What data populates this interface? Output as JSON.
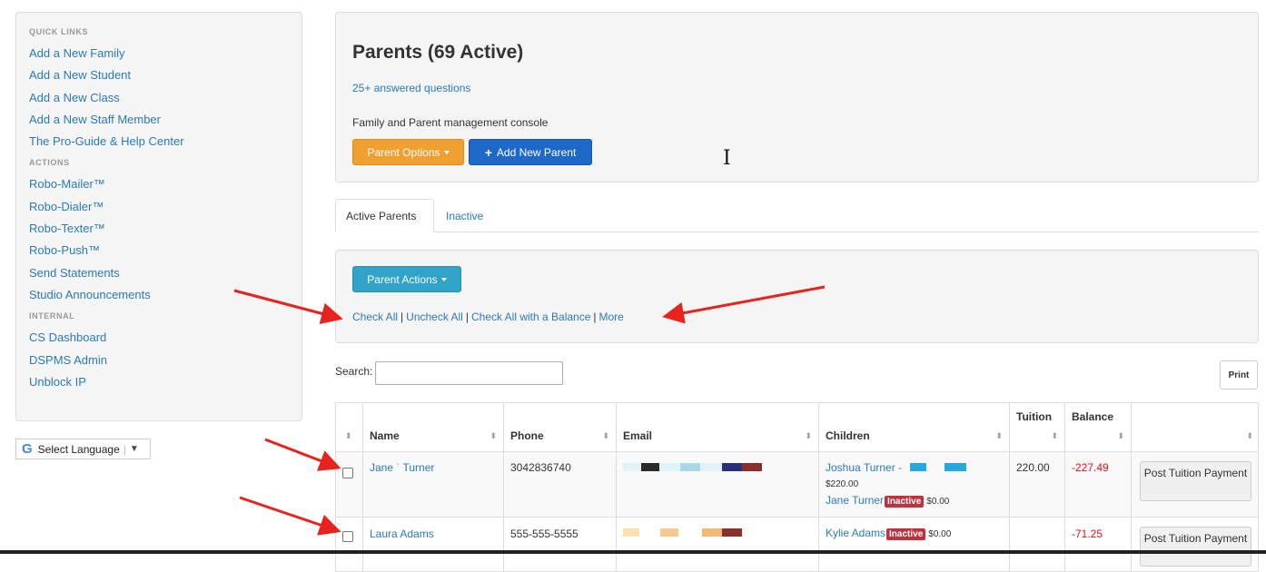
{
  "sidebar": {
    "sections": [
      {
        "heading": "QUICK LINKS",
        "links": [
          "Add a New Family",
          "Add a New Student",
          "Add a New Class",
          "Add a New Staff Member",
          "The Pro-Guide & Help Center"
        ]
      },
      {
        "heading": "ACTIONS",
        "links": [
          "Robo-Mailer™",
          "Robo-Dialer™",
          "Robo-Texter™",
          "Robo-Push™",
          "Send Statements",
          "Studio Announcements"
        ]
      },
      {
        "heading": "INTERNAL",
        "links": [
          "CS Dashboard",
          "DSPMS Admin",
          "Unblock IP"
        ]
      }
    ]
  },
  "translate": {
    "logo": "G",
    "label": "Select Language",
    "arrow": "▼"
  },
  "header": {
    "title": "Parents (69 Active)",
    "answered_link": "25+ answered questions",
    "subtitle": "Family and Parent management console",
    "options_btn": "Parent Options",
    "add_btn": "Add New Parent"
  },
  "tabs": [
    "Active Parents",
    "Inactive"
  ],
  "actions": {
    "button": "Parent Actions",
    "check_all": "Check All",
    "uncheck_all": "Uncheck All",
    "check_balance": "Check All with a Balance",
    "more": "More",
    "separator": "|"
  },
  "search": {
    "label": "Search:",
    "value": ""
  },
  "print_label": "Print",
  "table": {
    "columns": [
      "Name",
      "Phone",
      "Email",
      "Children",
      "Tuition",
      "Balance",
      ""
    ],
    "rows": [
      {
        "name": "Jane ˙ Turner",
        "phone": "3042836740",
        "child1": "Joshua Turner -",
        "child1_amount": "$220.00",
        "child2": "Jane Turner",
        "child2_badge": "Inactive",
        "child2_amount": "$0.00",
        "tuition": "220.00",
        "balance": "-227.49",
        "action": "Post Tuition Payment"
      },
      {
        "name": "Laura Adams",
        "phone": "555-555-5555",
        "child1": "Kylie Adams",
        "child1_badge": "Inactive",
        "child1_amount": "$0.00",
        "tuition": "",
        "balance": "-71.25",
        "action": "Post Tuition Payment"
      }
    ]
  },
  "colors": {
    "link": "#2a7ab8",
    "orange": "#f0a030",
    "blue": "#1d68c9",
    "cyan": "#31a3c9",
    "negative": "#e0101b",
    "badge": "#c0313d",
    "arrow": "#e8221d"
  }
}
